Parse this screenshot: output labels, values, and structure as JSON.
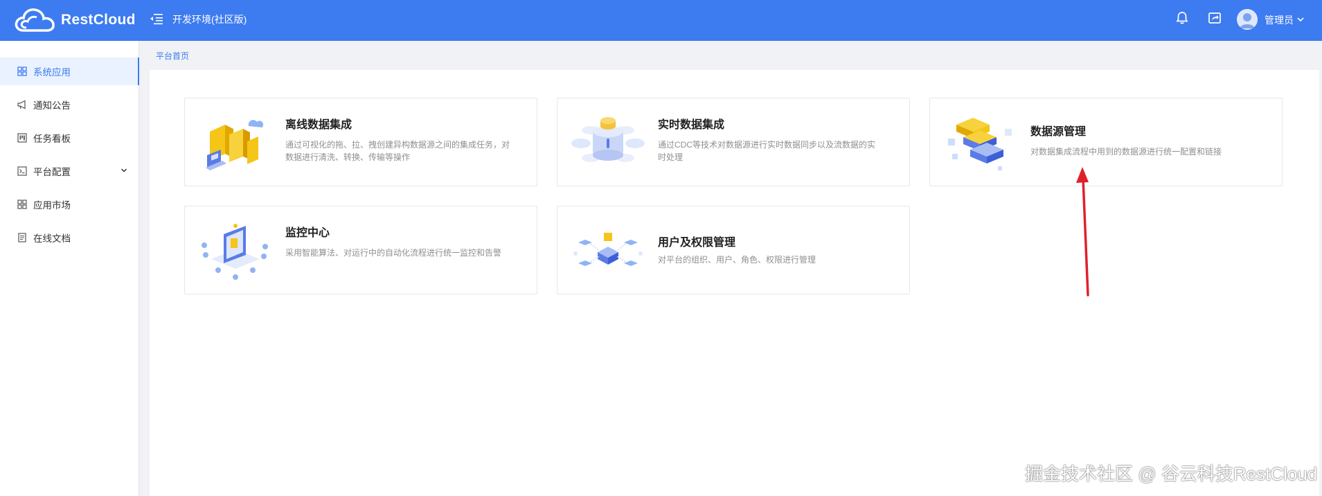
{
  "header": {
    "logo_text": "RestCloud",
    "env_title": "开发环境(社区版)",
    "user_name": "管理员"
  },
  "icons": {
    "menu_toggle": "menu-fold-icon",
    "notifications": "bell-icon",
    "share": "share-icon",
    "user_caret": "caret-down-icon"
  },
  "sidebar": {
    "items": [
      {
        "label": "系统应用",
        "icon": "grid-icon",
        "active": true
      },
      {
        "label": "通知公告",
        "icon": "megaphone-icon",
        "active": false
      },
      {
        "label": "任务看板",
        "icon": "kanban-icon",
        "active": false
      },
      {
        "label": "平台配置",
        "icon": "terminal-icon",
        "active": false,
        "has_submenu": true
      },
      {
        "label": "应用市场",
        "icon": "grid-icon",
        "active": false
      },
      {
        "label": "在线文档",
        "icon": "document-icon",
        "active": false
      }
    ]
  },
  "breadcrumb": "平台首页",
  "cards": [
    {
      "title": "离线数据集成",
      "desc": "通过可视化的拖、拉、拽创建异构数据源之间的集成任务，对数据进行清洗、转换、传输等操作",
      "illustration": "etl-illustration"
    },
    {
      "title": "实时数据集成",
      "desc": "通过CDC等技术对数据源进行实时数据同步以及流数据的实时处理",
      "illustration": "realtime-illustration"
    },
    {
      "title": "数据源管理",
      "desc": "对数据集成流程中用到的数据源进行统一配置和链接",
      "illustration": "datasource-illustration"
    },
    {
      "title": "监控中心",
      "desc": "采用智能算法、对运行中的自动化流程进行统一监控和告警",
      "illustration": "monitor-illustration"
    },
    {
      "title": "用户及权限管理",
      "desc": "对平台的组织、用户、角色、权限进行管理",
      "illustration": "users-illustration"
    }
  ],
  "watermark": "掘金技术社区 @ 谷云科技RestCloud",
  "colors": {
    "primary": "#3d7bf0",
    "annotation_arrow": "#e0202a"
  }
}
